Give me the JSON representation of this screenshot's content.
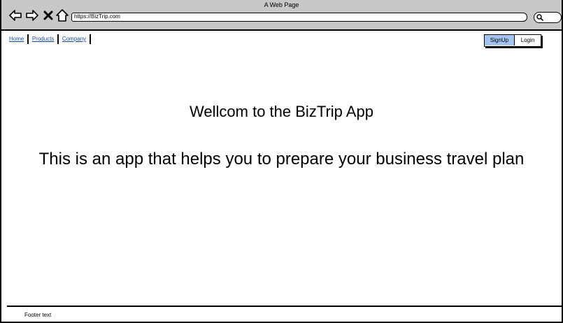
{
  "window": {
    "title": "A Web Page"
  },
  "browser": {
    "url": "https://BizTrip.com",
    "icons": {
      "back": "arrow-left-icon",
      "forward": "arrow-right-icon",
      "stop": "close-icon",
      "home": "home-icon",
      "search": "search-icon"
    }
  },
  "nav": {
    "links": [
      {
        "label": "Home"
      },
      {
        "label": "Products"
      },
      {
        "label": "Company"
      }
    ]
  },
  "auth": {
    "signup_label": "SignUp",
    "login_label": "Login"
  },
  "main": {
    "headline": "Wellcom to the BizTrip App",
    "tagline": "This is an app that helps you to prepare your business travel plan"
  },
  "footer": {
    "text": "Footer text"
  },
  "colors": {
    "chrome": "#c8c8c8",
    "link": "#1a4a9b",
    "signup": "#a3c4f0"
  }
}
